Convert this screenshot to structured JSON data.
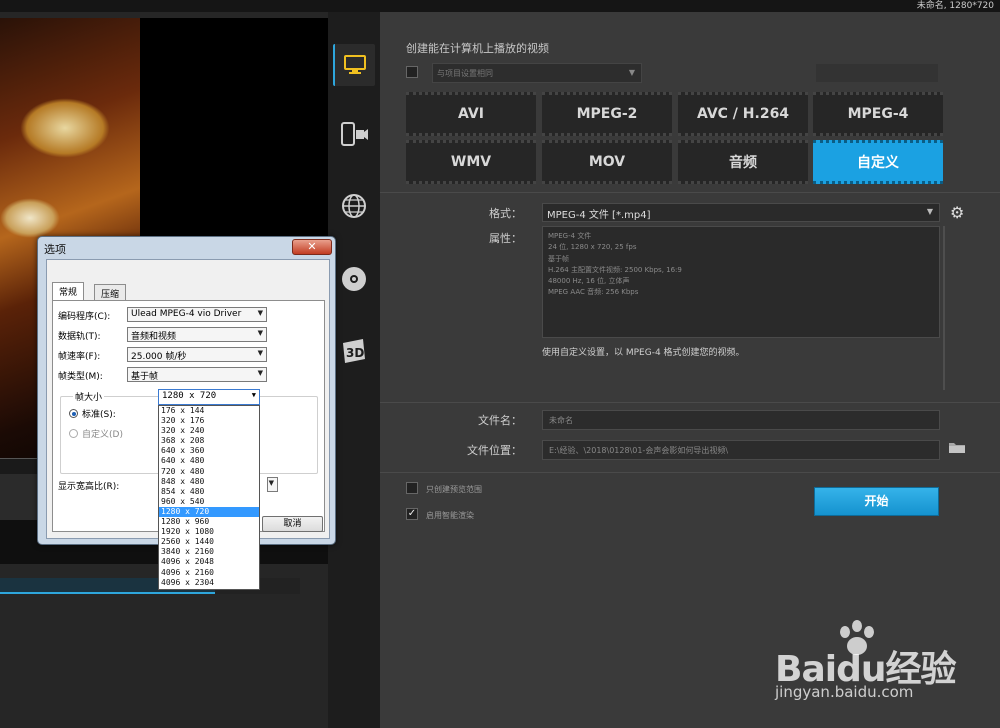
{
  "window": {
    "title": "未命名, 1280*720"
  },
  "sidebar": {
    "icons": [
      "computer-icon",
      "mobile-device-icon",
      "globe-icon",
      "disc-icon",
      "3d-icon"
    ],
    "label_3d": "3D"
  },
  "right": {
    "title": "创建能在计算机上播放的视频",
    "same_as_project_label": "与项目设置相同",
    "formats": [
      {
        "label": "AVI"
      },
      {
        "label": "MPEG-2"
      },
      {
        "label": "AVC / H.264"
      },
      {
        "label": "MPEG-4"
      },
      {
        "label": "WMV"
      },
      {
        "label": "MOV"
      },
      {
        "label": "音频"
      },
      {
        "label": "自定义"
      }
    ],
    "selected_format": "自定义",
    "format_label": "格式：",
    "format_value": "MPEG-4 文件 [*.mp4]",
    "props_label": "属性：",
    "props_lines": [
      "MPEG-4 文件",
      "24 位, 1280 x 720, 25 fps",
      "基于帧",
      "H.264 主配置文件视频: 2500 Kbps, 16:9",
      "48000 Hz, 16 位, 立体声",
      "MPEG AAC 音频: 256 Kbps"
    ],
    "description": "使用自定义设置，以 MPEG-4 格式创建您的视频。",
    "filename_label": "文件名：",
    "filename_value": "未命名",
    "location_label": "文件位置：",
    "location_value": "E:\\经验、\\2018\\0128\\01-会声会影如何导出视频\\",
    "option1": "只创建预览范围",
    "option2": "启用智能渲染",
    "start_button": "开始"
  },
  "dialog": {
    "title": "选项",
    "close": "✕",
    "tabs": [
      "常规",
      "压缩"
    ],
    "rows": [
      {
        "label": "编码程序(C):",
        "value": "Ulead MPEG-4 vio Driver"
      },
      {
        "label": "数据轨(T):",
        "value": "音频和视频"
      },
      {
        "label": "帧速率(F):",
        "value": "25.000 帧/秒"
      },
      {
        "label": "帧类型(M):",
        "value": "基于帧"
      }
    ],
    "frame_size_group": "帧大小",
    "standard_label": "标准(S):",
    "custom_label": "自定义(D)",
    "size_value": "1280 x 720",
    "aspect_label": "显示宽高比(R):",
    "cancel": "取消",
    "size_options": [
      "176 x 144",
      "320 x 176",
      "320 x 240",
      "368 x 208",
      "640 x 360",
      "640 x 480",
      "720 x 480",
      "848 x 480",
      "854 x 480",
      "960 x 540",
      "1280 x 720",
      "1280 x 960",
      "1920 x 1080",
      "2560 x 1440",
      "3840 x 2160",
      "4096 x 2048",
      "4096 x 2160",
      "4096 x 2304"
    ]
  },
  "watermark": {
    "logo": "Baidu经验",
    "site": "jingyan.baidu.com"
  }
}
